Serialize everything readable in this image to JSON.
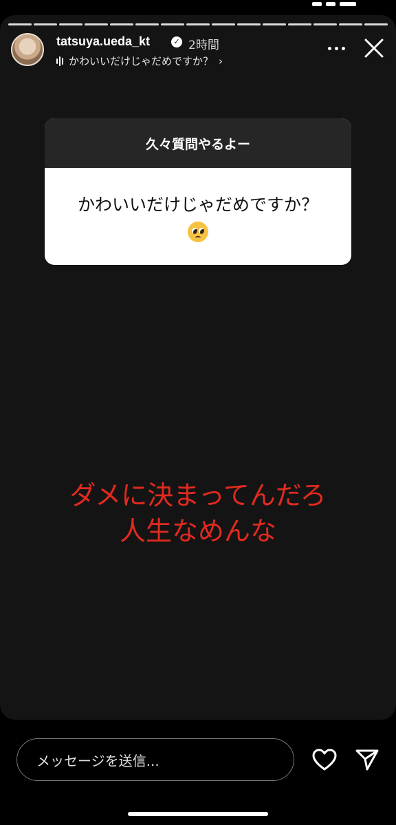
{
  "story": {
    "username": "tatsuya.ueda_kt",
    "time_ago": "2時間",
    "subtitle": "かわいいだけじゃだめですか？",
    "segments": 15
  },
  "question": {
    "prompt": "久々質問やるよー",
    "text": "かわいいだけじゃだめですか？",
    "emoji": "pleading-face"
  },
  "answer": {
    "line1": "ダメに決まってんだろ",
    "line2": "人生なめんな",
    "color": "#e22a1f"
  },
  "reply": {
    "placeholder": "メッセージを送信..."
  },
  "icons": [
    "verified-badge-icon",
    "music-bars-icon",
    "chevron-right-icon",
    "more-icon",
    "close-icon",
    "heart-icon",
    "send-icon"
  ]
}
